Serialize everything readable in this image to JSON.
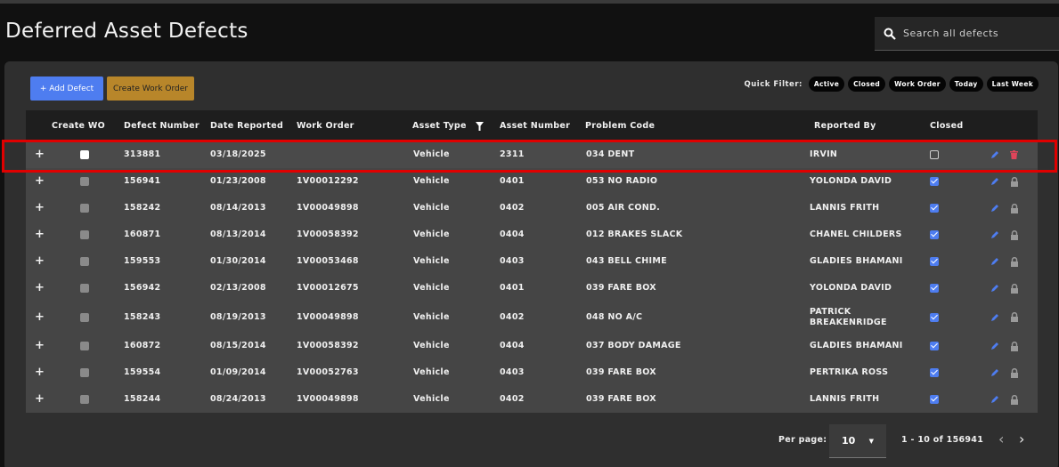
{
  "header": {
    "title": "Deferred Asset Defects",
    "search_placeholder": "Search all defects"
  },
  "toolbar": {
    "add_label": "+ Add Defect",
    "work_order_label": "Create Work Order",
    "quick_filter_label": "Quick Filter:",
    "chips": [
      "Active",
      "Closed",
      "Work Order",
      "Today",
      "Last Week"
    ]
  },
  "table": {
    "columns": [
      "Create WO",
      "Defect Number",
      "Date Reported",
      "Work Order",
      "Asset Type",
      "Asset Number",
      "Problem Code",
      "Reported By",
      "Closed"
    ],
    "rows": [
      {
        "defect": "313881",
        "date": "03/18/2025",
        "wo": "",
        "type": "Vehicle",
        "asset": "2311",
        "problem": "034 DENT",
        "by": "IRVIN",
        "closed": false
      },
      {
        "defect": "156941",
        "date": "01/23/2008",
        "wo": "1V00012292",
        "type": "Vehicle",
        "asset": "0401",
        "problem": "053 NO RADIO",
        "by": "YOLONDA DAVID",
        "closed": true
      },
      {
        "defect": "158242",
        "date": "08/14/2013",
        "wo": "1V00049898",
        "type": "Vehicle",
        "asset": "0402",
        "problem": "005 AIR COND.",
        "by": "LANNIS FRITH",
        "closed": true
      },
      {
        "defect": "160871",
        "date": "08/13/2014",
        "wo": "1V00058392",
        "type": "Vehicle",
        "asset": "0404",
        "problem": "012 BRAKES SLACK",
        "by": "CHANEL CHILDERS",
        "closed": true
      },
      {
        "defect": "159553",
        "date": "01/30/2014",
        "wo": "1V00053468",
        "type": "Vehicle",
        "asset": "0403",
        "problem": "043 BELL CHIME",
        "by": "GLADIES BHAMANI",
        "closed": true
      },
      {
        "defect": "156942",
        "date": "02/13/2008",
        "wo": "1V00012675",
        "type": "Vehicle",
        "asset": "0401",
        "problem": "039 FARE BOX",
        "by": "YOLONDA DAVID",
        "closed": true
      },
      {
        "defect": "158243",
        "date": "08/19/2013",
        "wo": "1V00049898",
        "type": "Vehicle",
        "asset": "0402",
        "problem": "048 NO A/C",
        "by": "PATRICK BREAKENRIDGE",
        "closed": true
      },
      {
        "defect": "160872",
        "date": "08/15/2014",
        "wo": "1V00058392",
        "type": "Vehicle",
        "asset": "0404",
        "problem": "037 BODY DAMAGE",
        "by": "GLADIES BHAMANI",
        "closed": true
      },
      {
        "defect": "159554",
        "date": "01/09/2014",
        "wo": "1V00052763",
        "type": "Vehicle",
        "asset": "0403",
        "problem": "039 FARE BOX",
        "by": "PERTRIKA ROSS",
        "closed": true
      },
      {
        "defect": "158244",
        "date": "08/24/2013",
        "wo": "1V00049898",
        "type": "Vehicle",
        "asset": "0402",
        "problem": "039 FARE BOX",
        "by": "LANNIS FRITH",
        "closed": true
      }
    ]
  },
  "pagination": {
    "per_page_label": "Per page:",
    "per_page_value": "10",
    "range_label": "1 - 10 of 156941"
  },
  "colors": {
    "accent_blue": "#4e7df0",
    "work_order_gold": "#b8862a",
    "highlight_red": "#e00000",
    "delete_red": "#e0455a"
  }
}
